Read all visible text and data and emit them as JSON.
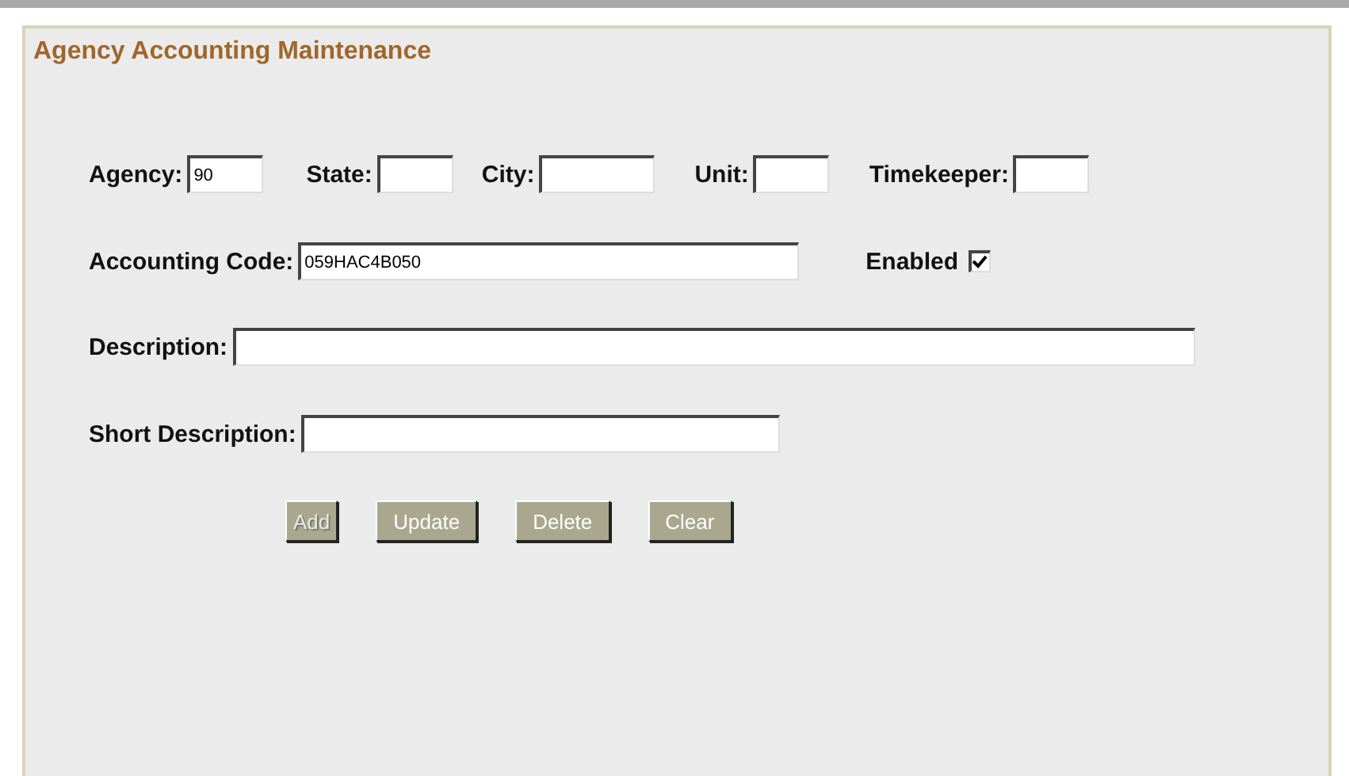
{
  "title": "Agency Accounting Maintenance",
  "row_1": [
    {
      "label": "Agency:",
      "value": "90"
    },
    {
      "label": "State:"
    },
    {
      "label": "City:"
    },
    {
      "label": "Unit:"
    },
    {
      "label": "Timekeeper:"
    }
  ],
  "accounting_code": {
    "label": "Accounting Code:",
    "value": "059HAC4B050"
  },
  "enabled": {
    "label": "Enabled",
    "checked": true
  },
  "description": {
    "label": "Description:"
  },
  "short_description": {
    "label": "Short Description:"
  },
  "buttons": [
    {
      "label": "Add",
      "disabled": true
    },
    {
      "label": "Update",
      "disabled": false
    },
    {
      "label": "Delete",
      "disabled": false
    },
    {
      "label": "Clear",
      "disabled": false
    }
  ]
}
